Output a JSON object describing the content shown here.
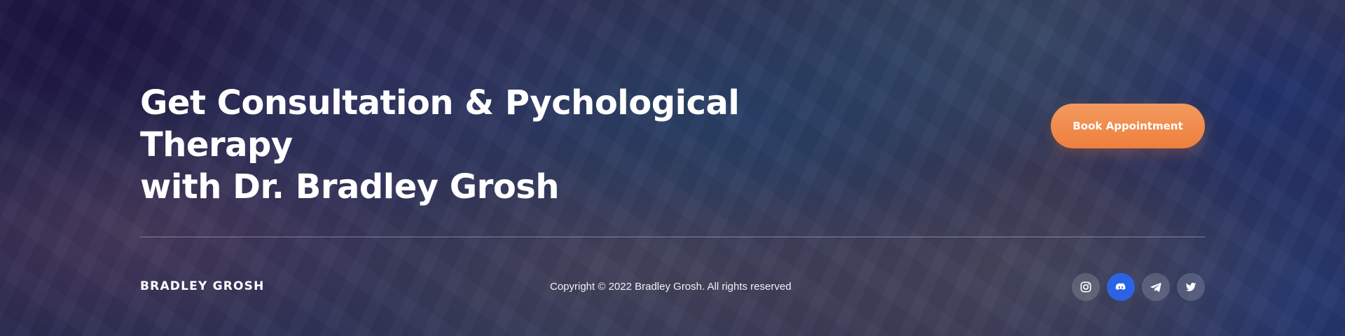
{
  "hero": {
    "headline_line1": "Get Consultation & Pychological Therapy",
    "headline_line2": "with Dr. Bradley Grosh",
    "cta_label": "Book Appointment"
  },
  "footer": {
    "brand": "BRADLEY GROSH",
    "copyright": "Copyright © 2022 Bradley Grosh. All rights reserved",
    "socials": [
      {
        "icon": "instagram-icon",
        "active": false
      },
      {
        "icon": "discord-icon",
        "active": true
      },
      {
        "icon": "telegram-icon",
        "active": false
      },
      {
        "icon": "twitter-icon",
        "active": false
      }
    ]
  },
  "colors": {
    "accent_button": "#F08848",
    "active_social": "#2C63E4",
    "divider": "#C8CEDC"
  }
}
